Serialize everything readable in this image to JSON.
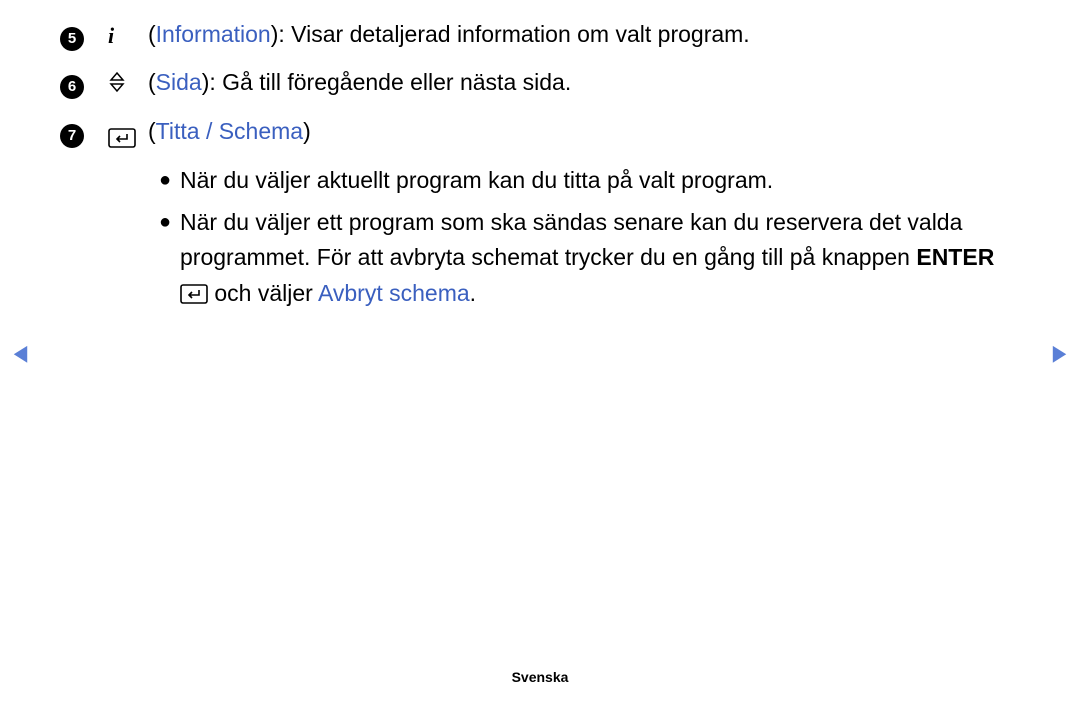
{
  "items": [
    {
      "num": "5",
      "label": "Information",
      "desc": ": Visar detaljerad information om valt program."
    },
    {
      "num": "6",
      "label": "Sida",
      "desc": ": Gå till föregående eller nästa sida."
    },
    {
      "num": "7",
      "label": "Titta / Schema",
      "desc": ""
    }
  ],
  "bullets": [
    {
      "text": "När du väljer aktuellt program kan du titta på valt program."
    },
    {
      "part1": "När du väljer ett program som ska sändas senare kan du reservera det valda programmet. För att avbryta schemat trycker du en gång till på knappen ",
      "enter": "ENTER",
      "part2": " och väljer ",
      "cancel": "Avbryt schema",
      "part3": "."
    }
  ],
  "footer": "Svenska"
}
